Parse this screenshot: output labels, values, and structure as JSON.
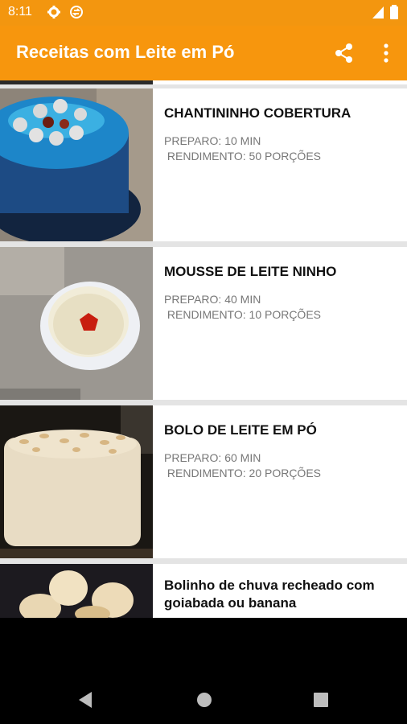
{
  "status_bar": {
    "time": "8:11",
    "left_icons": [
      "settings-icon",
      "sync-icon"
    ],
    "right_icons": [
      "signal-icon",
      "battery-icon"
    ]
  },
  "app_bar": {
    "title": "Receitas com Leite em Pó",
    "background": "#f7960d",
    "actions": [
      "share-icon",
      "more-vert-icon"
    ]
  },
  "recipes": [
    {
      "title": "CHANTININHO COBERTURA",
      "prep": "PREPARO: 10 MIN",
      "yield": " RENDIMENTO: 50 PORÇÕES",
      "image": "blue frosted cake"
    },
    {
      "title": "MOUSSE DE LEITE NINHO",
      "prep": "PREPARO: 40 MIN",
      "yield": " RENDIMENTO: 10 PORÇÕES",
      "image": "mousse bowl with strawberry"
    },
    {
      "title": "BOLO DE LEITE EM PÓ",
      "prep": "PREPARO: 60 MIN",
      "yield": " RENDIMENTO: 20 PORÇÕES",
      "image": "cream cake with almonds"
    },
    {
      "title": "Bolinho de chuva recheado com goiabada ou banana",
      "image": "sugared fritters"
    }
  ],
  "nav_bar": [
    "back-icon",
    "home-icon",
    "recents-icon"
  ]
}
